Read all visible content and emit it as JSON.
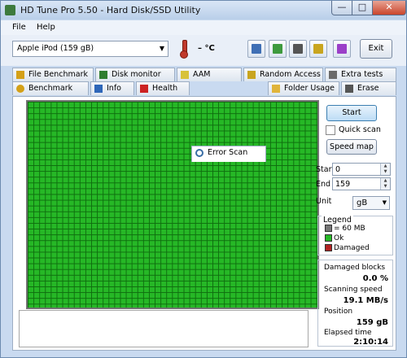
{
  "window": {
    "title": "HD Tune Pro 5.50 - Hard Disk/SSD Utility",
    "minimize_glyph": "—",
    "maximize_glyph": "□",
    "close_glyph": "✕"
  },
  "menu": {
    "items": [
      "File",
      "Help"
    ]
  },
  "toolbar": {
    "drive": "Apple   iPod (159 gB)",
    "temperature": "– °C",
    "exit_label": "Exit",
    "icons": [
      "copy-info-icon",
      "copy-screen-icon",
      "camera-icon",
      "tools-icon",
      "download-icon"
    ],
    "icon_colors": [
      "#3f6fb5",
      "#3e9a3e",
      "#555555",
      "#c9a51e",
      "#9b3fc8"
    ]
  },
  "tabs": {
    "row1": [
      "File Benchmark",
      "Disk monitor",
      "AAM",
      "Random Access",
      "Extra tests"
    ],
    "row2": [
      "Benchmark",
      "Info",
      "Health",
      "Error Scan",
      "Folder Usage",
      "Erase"
    ],
    "active": "Error Scan"
  },
  "scan": {
    "start_label": "Start",
    "quick_scan_label": "Quick scan",
    "quick_scan_checked": false,
    "speed_map_label": "Speed map",
    "start_field_label": "Start",
    "start_value": "0",
    "end_field_label": "End",
    "end_value": "159",
    "unit_label": "Unit",
    "unit_value": "gB",
    "legend": {
      "title": "Legend",
      "block_size": "= 60 MB",
      "ok": "Ok",
      "damaged": "Damaged",
      "colors": {
        "block": "#777777",
        "ok": "#26b826",
        "damaged": "#b22222"
      }
    },
    "stats": {
      "damaged_blocks_label": "Damaged blocks",
      "damaged_blocks_value": "0.0 %",
      "scanning_speed_label": "Scanning speed",
      "scanning_speed_value": "19.1 MB/s",
      "position_label": "Position",
      "position_value": "159 gB",
      "elapsed_label": "Elapsed time",
      "elapsed_value": "2:10:14"
    }
  }
}
